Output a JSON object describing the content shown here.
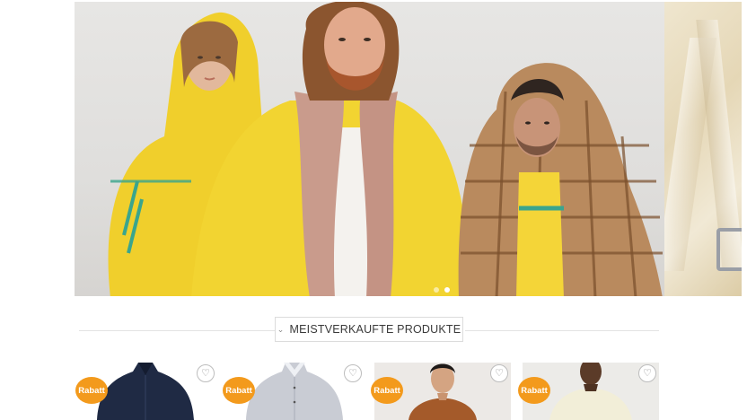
{
  "hero": {
    "slides": [
      {
        "active": false
      },
      {
        "active": true
      }
    ]
  },
  "section": {
    "title": "MEISTVERKAUFTE PRODUKTE",
    "chevron": "⌄"
  },
  "products": [
    {
      "badge": "Rabatt",
      "wishlist_icon": "heart-icon",
      "color": "#1f2a44"
    },
    {
      "badge": "Rabatt",
      "wishlist_icon": "heart-icon",
      "color": "#c9ccd4"
    },
    {
      "badge": "Rabatt",
      "wishlist_icon": "heart-icon",
      "color": "#a45a2a"
    },
    {
      "badge": "Rabatt",
      "wishlist_icon": "heart-icon",
      "color": "#f2eed8"
    }
  ],
  "colors": {
    "badge": "#f39a1c",
    "accent_yellow": "#f2d22e",
    "scarf_pink": "#c99b8c"
  }
}
